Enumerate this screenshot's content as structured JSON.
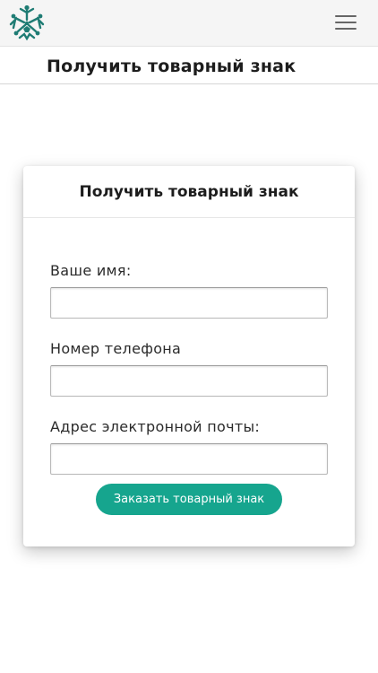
{
  "header": {
    "logo_icon": "snowflake-people-logo-icon",
    "brand_color": "#1f7c74",
    "menu_icon": "hamburger-menu-icon"
  },
  "page": {
    "title": "Получить товарный знак"
  },
  "form": {
    "title": "Получить товарный знак",
    "fields": [
      {
        "label": "Ваше имя:",
        "value": "",
        "placeholder": ""
      },
      {
        "label": "Номер телефона",
        "value": "",
        "placeholder": ""
      },
      {
        "label": "Адрес электронной почты:",
        "value": "",
        "placeholder": ""
      }
    ],
    "submit_label": "Заказать товарный знак",
    "submit_color": "#16a58e"
  }
}
